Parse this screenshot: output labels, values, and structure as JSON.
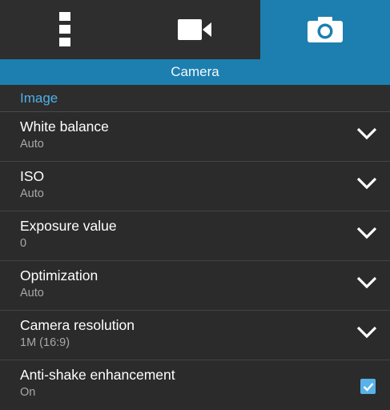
{
  "tabs": [
    {
      "icon": "menu-dots-icon",
      "active": false
    },
    {
      "icon": "video-camera-icon",
      "active": false
    },
    {
      "icon": "photo-camera-icon",
      "active": true
    }
  ],
  "title": "Camera",
  "section": "Image",
  "settings": [
    {
      "label": "White balance",
      "value": "Auto",
      "control": "dropdown"
    },
    {
      "label": "ISO",
      "value": "Auto",
      "control": "dropdown"
    },
    {
      "label": "Exposure value",
      "value": "0",
      "control": "dropdown"
    },
    {
      "label": "Optimization",
      "value": "Auto",
      "control": "dropdown"
    },
    {
      "label": "Camera resolution",
      "value": "1M (16:9)",
      "control": "dropdown"
    },
    {
      "label": "Anti-shake enhancement",
      "value": "On",
      "control": "checkbox",
      "checked": true
    }
  ],
  "colors": {
    "accent": "#1c7fb0",
    "section_text": "#4fb0e8",
    "checkbox": "#58b2ea",
    "background": "#2b2b2b"
  }
}
